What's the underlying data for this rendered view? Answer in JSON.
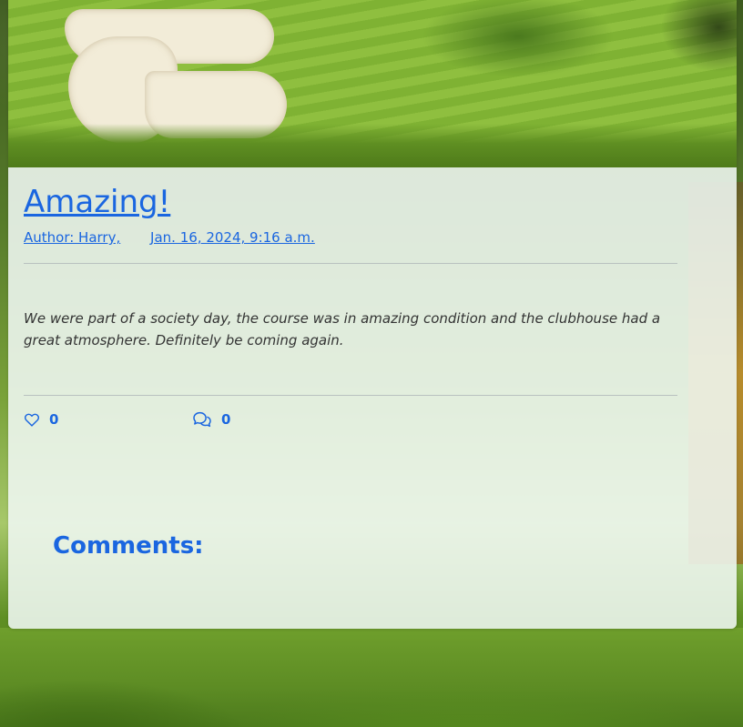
{
  "post": {
    "title": "Amazing!",
    "author": "Author: Harry,",
    "date": "Jan. 16, 2024, 9:16 a.m.",
    "body": "We were part of a society day, the course was in amazing condition and the clubhouse had a great atmosphere. Definitely be coming again.",
    "likes": "0",
    "comments_count": "0"
  },
  "comments_section": {
    "heading": "Comments:"
  },
  "colors": {
    "accent": "#1a66e0",
    "card_bg": "#f0f8f4"
  },
  "icons": {
    "like": "heart-outline-icon",
    "comments": "chat-bubbles-icon"
  }
}
